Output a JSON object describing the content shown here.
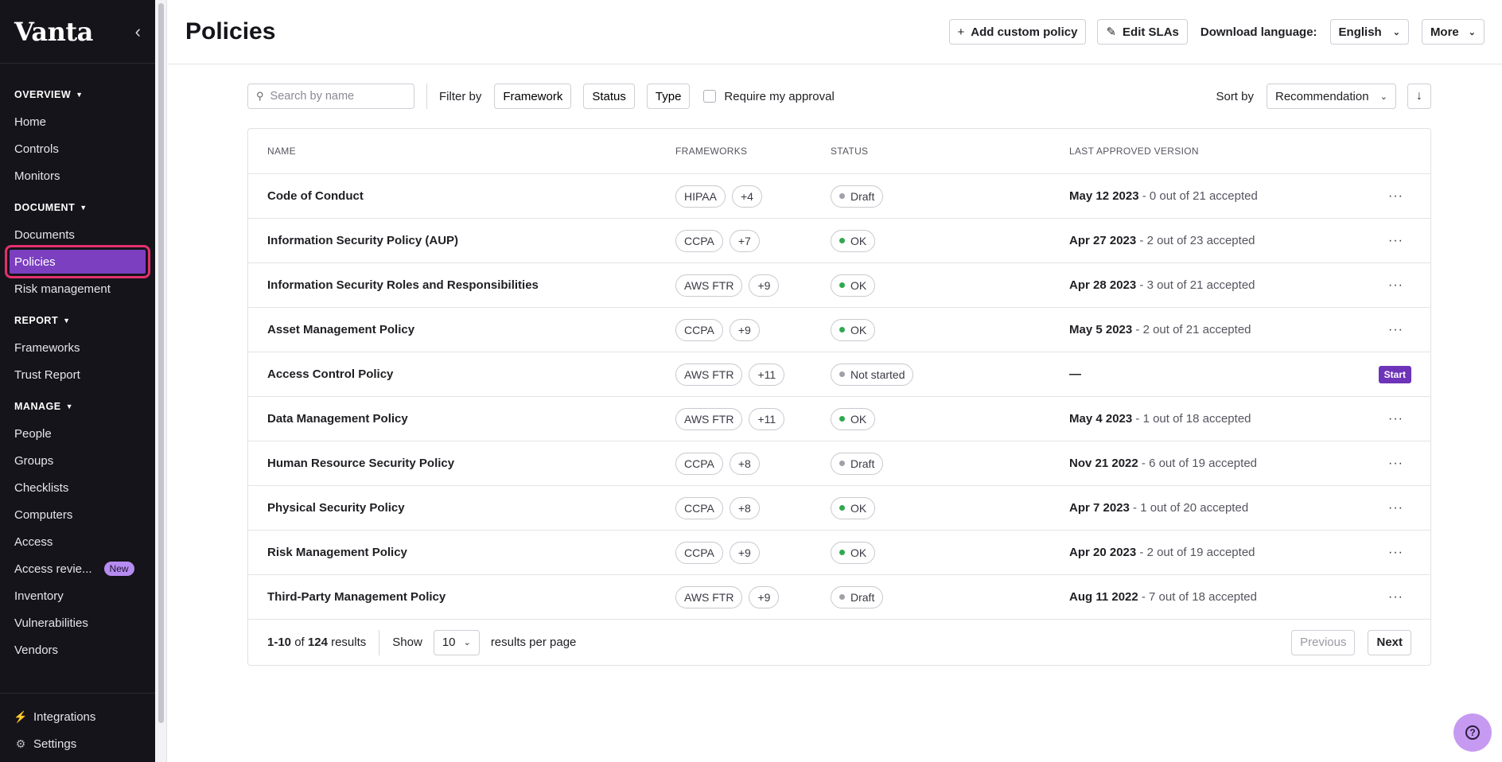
{
  "app": {
    "logo": "Vanta",
    "collapse_icon": "chevron-left-icon"
  },
  "sidebar": {
    "sections": [
      {
        "title": "OVERVIEW",
        "items": [
          "Home",
          "Controls",
          "Monitors"
        ]
      },
      {
        "title": "DOCUMENT",
        "items": [
          "Documents",
          "Policies",
          "Risk management"
        ]
      },
      {
        "title": "REPORT",
        "items": [
          "Frameworks",
          "Trust Report"
        ]
      },
      {
        "title": "MANAGE",
        "items": [
          "People",
          "Groups",
          "Checklists",
          "Computers",
          "Access",
          "Access revie...",
          "Inventory",
          "Vulnerabilities",
          "Vendors"
        ]
      }
    ],
    "active_item": "Policies",
    "badge": "New",
    "bottom": {
      "integrations": "Integrations",
      "settings": "Settings"
    }
  },
  "header": {
    "title": "Policies",
    "add_custom_policy": "Add custom policy",
    "edit_slas": "Edit SLAs",
    "download_language_label": "Download language:",
    "language": "English",
    "more": "More"
  },
  "toolbar": {
    "search_placeholder": "Search by name",
    "filter_by": "Filter by",
    "framework": "Framework",
    "status": "Status",
    "type": "Type",
    "require_approval": "Require my approval",
    "sort_by": "Sort by",
    "sort_value": "Recommendation"
  },
  "table": {
    "headers": {
      "name": "NAME",
      "frameworks": "FRAMEWORKS",
      "status": "STATUS",
      "last_approved": "LAST APPROVED VERSION"
    },
    "rows": [
      {
        "name": "Code of Conduct",
        "fw": "HIPAA",
        "fw_more": "+4",
        "status": "Draft",
        "date": "May 12 2023",
        "accepted": " - 0 out of 21 accepted"
      },
      {
        "name": "Information Security Policy (AUP)",
        "fw": "CCPA",
        "fw_more": "+7",
        "status": "OK",
        "date": "Apr 27 2023",
        "accepted": " - 2 out of 23 accepted"
      },
      {
        "name": "Information Security Roles and Responsibilities",
        "fw": "AWS FTR",
        "fw_more": "+9",
        "status": "OK",
        "date": "Apr 28 2023",
        "accepted": " - 3 out of 21 accepted"
      },
      {
        "name": "Asset Management Policy",
        "fw": "CCPA",
        "fw_more": "+9",
        "status": "OK",
        "date": "May 5 2023",
        "accepted": " - 2 out of 21 accepted"
      },
      {
        "name": "Access Control Policy",
        "fw": "AWS FTR",
        "fw_more": "+11",
        "status": "Not started",
        "date": "—",
        "accepted": "",
        "action": "Start"
      },
      {
        "name": "Data Management Policy",
        "fw": "AWS FTR",
        "fw_more": "+11",
        "status": "OK",
        "date": "May 4 2023",
        "accepted": " - 1 out of 18 accepted"
      },
      {
        "name": "Human Resource Security Policy",
        "fw": "CCPA",
        "fw_more": "+8",
        "status": "Draft",
        "date": "Nov 21 2022",
        "accepted": " - 6 out of 19 accepted"
      },
      {
        "name": "Physical Security Policy",
        "fw": "CCPA",
        "fw_more": "+8",
        "status": "OK",
        "date": "Apr 7 2023",
        "accepted": " - 1 out of 20 accepted"
      },
      {
        "name": "Risk Management Policy",
        "fw": "CCPA",
        "fw_more": "+9",
        "status": "OK",
        "date": "Apr 20 2023",
        "accepted": " - 2 out of 19 accepted"
      },
      {
        "name": "Third-Party Management Policy",
        "fw": "AWS FTR",
        "fw_more": "+9",
        "status": "Draft",
        "date": "Aug 11 2022",
        "accepted": " - 7 out of 18 accepted"
      }
    ],
    "more_icon": "···"
  },
  "footer": {
    "range": "1-10",
    "of": " of ",
    "total": "124",
    "results": " results",
    "show": "Show",
    "per_page_value": "10",
    "results_per_page": "results per page",
    "previous": "Previous",
    "next": "Next"
  },
  "colors": {
    "active_nav": "#7b3fbf",
    "highlight": "#e3306e",
    "ok_dot": "#2fa84f",
    "draft_dot": "#a0a0aa",
    "start": "#6d33b8",
    "help": "#c79af2"
  },
  "help": {
    "icon": "question-icon"
  }
}
